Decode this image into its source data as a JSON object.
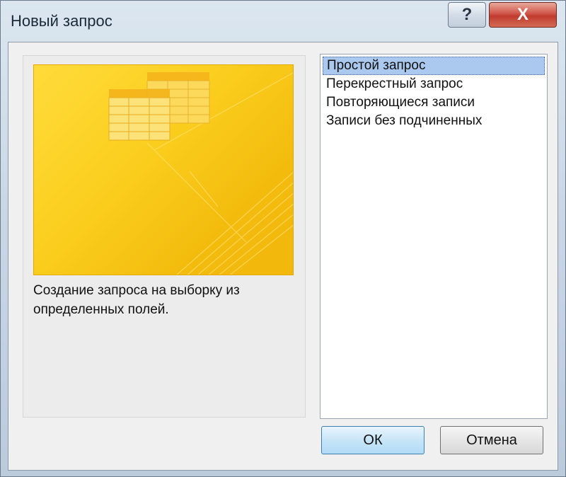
{
  "dialog": {
    "title": "Новый запрос",
    "help_glyph": "?",
    "close_glyph": "X"
  },
  "preview": {
    "description": "Создание запроса на выборку из определенных полей."
  },
  "list": {
    "items": [
      {
        "label": "Простой запрос",
        "selected": true
      },
      {
        "label": "Перекрестный запрос",
        "selected": false
      },
      {
        "label": "Повторяющиеся записи",
        "selected": false
      },
      {
        "label": "Записи без подчиненных",
        "selected": false
      }
    ]
  },
  "buttons": {
    "ok_label": "ОК",
    "cancel_label": "Отмена"
  },
  "colors": {
    "selection": "#abc8ee",
    "preview_yellow": "#fbcf1f",
    "close_red": "#c03b2e"
  }
}
